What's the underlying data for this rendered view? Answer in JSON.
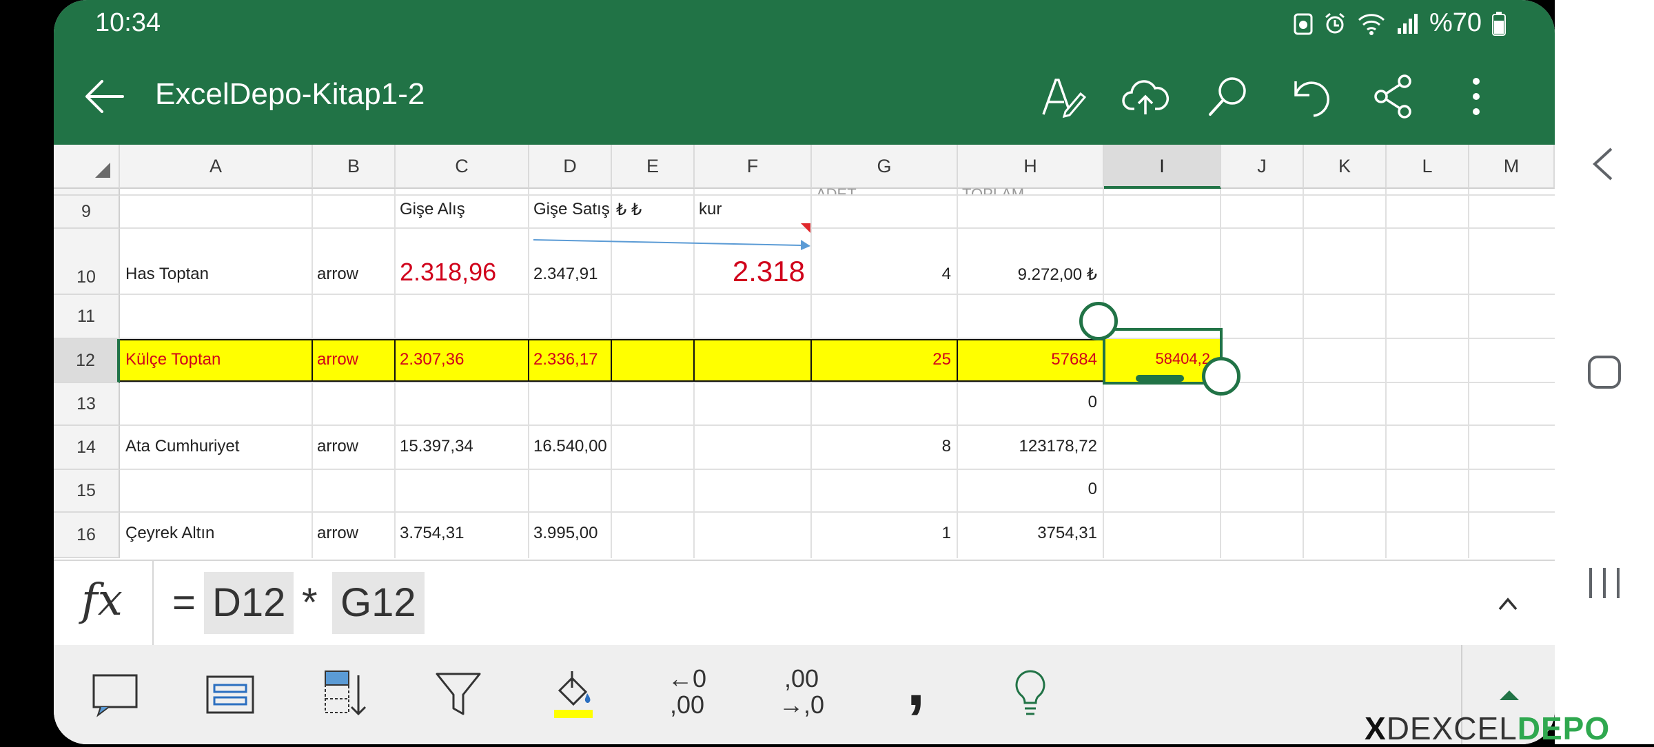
{
  "status_bar": {
    "time": "10:34",
    "battery": "%70"
  },
  "app_bar": {
    "title": "ExcelDepo-Kitap1-2"
  },
  "column_headers": [
    "A",
    "B",
    "C",
    "D",
    "E",
    "F",
    "G",
    "H",
    "I",
    "J",
    "K",
    "L",
    "M"
  ],
  "row_headers": [
    "9",
    "10",
    "11",
    "12",
    "13",
    "14",
    "15",
    "16"
  ],
  "partial_row_text": {
    "g": "ADET",
    "h": "TOPLAM"
  },
  "rows": {
    "r9": {
      "c": "Gişe Alış",
      "d": "Gişe Satış",
      "e": "₺ ₺",
      "f": "kur"
    },
    "r10": {
      "a": "Has Toptan",
      "b": "arrow",
      "c": "2.318,96",
      "d": "2.347,91",
      "f": "2.318",
      "g": "4",
      "h": "9.272,00 ₺"
    },
    "r12": {
      "a": "Külçe Toptan",
      "b": "arrow",
      "c": "2.307,36",
      "d": "2.336,17",
      "g": "25",
      "h": "57684",
      "i": "58404,2"
    },
    "r13": {
      "h": "0"
    },
    "r14": {
      "a": "Ata Cumhuriyet",
      "b": "arrow",
      "c": "15.397,34",
      "d": "16.540,00",
      "g": "8",
      "h": "123178,72"
    },
    "r15": {
      "h": "0"
    },
    "r16": {
      "a": "Çeyrek Altın",
      "b": "arrow",
      "c": "3.754,31",
      "d": "3.995,00",
      "g": "1",
      "h": "3754,31"
    }
  },
  "formula": {
    "fx": "fx",
    "equals": "=",
    "ref1": "D12",
    "op": "*",
    "ref2": "G12"
  },
  "bottom_toolbar": {
    "dec_inc_top": "←0",
    "dec_inc_bottom": ",00",
    "dec_dec_top": ",00",
    "dec_dec_bottom": "→,0",
    "comma": ","
  },
  "watermark": {
    "prefix": "X",
    "text": "DEXCEL",
    "brand": "DEPO"
  },
  "colors": {
    "excel_green": "#217346",
    "highlight_yellow": "#ffff00",
    "red_text": "#d0021b"
  }
}
